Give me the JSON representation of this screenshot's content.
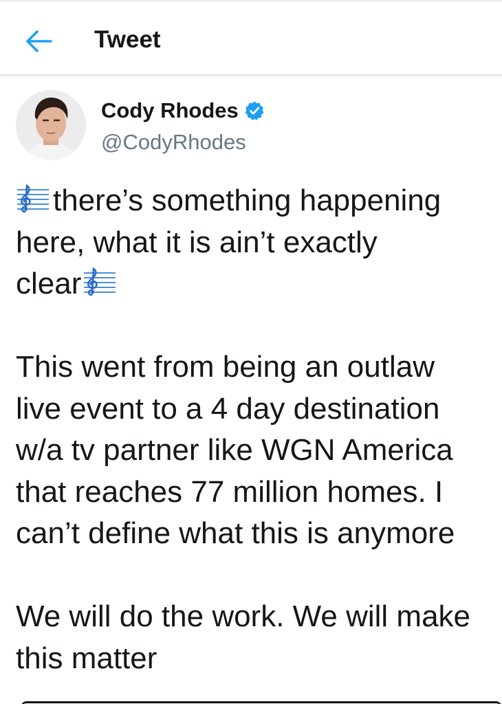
{
  "header": {
    "back_icon": "arrow-left-icon",
    "title": "Tweet"
  },
  "author": {
    "display_name": "Cody Rhodes",
    "verified_icon": "verified-badge-icon",
    "handle": "@CodyRhodes"
  },
  "tweet": {
    "paragraph1": {
      "line1": "there’s something happening",
      "line2": "here, what it is ain’t exactly",
      "line3": "clear"
    },
    "paragraph2": {
      "line1": "This went from being an outlaw",
      "line2": "live event to a 4 day destination",
      "line3": "w/a tv partner like WGN America",
      "line4": "that reaches 77 million homes. I",
      "line5": "can’t define what this is anymore"
    },
    "paragraph3": {
      "line1": "We will do the work. We will make",
      "line2": "this matter"
    },
    "emoji_icon": "musical-score-icon"
  },
  "colors": {
    "accent": "#1da1f2",
    "text": "#14171a",
    "secondary_text": "#657786"
  }
}
